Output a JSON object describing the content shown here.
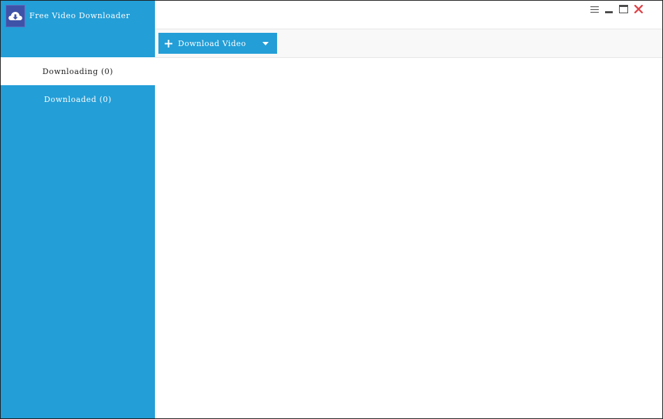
{
  "app": {
    "title": "Free Video Downloader"
  },
  "nav": {
    "items": [
      {
        "label": "Downloading (0)",
        "active": true
      },
      {
        "label": "Downloaded (0)",
        "active": false
      }
    ]
  },
  "toolbar": {
    "download_label": "Download Video"
  },
  "icons": {
    "logo": "cloud-download-icon",
    "menu": "menu-icon",
    "minimize": "minimize-icon",
    "maximize": "maximize-icon",
    "close": "close-icon",
    "add": "plus-icon",
    "dropdown": "caret-down-icon"
  },
  "colors": {
    "sidebar": "#239ed7",
    "logo_bg": "#3e53a7",
    "close": "#e0454a",
    "toolbar_bg": "#f8f8f8"
  }
}
